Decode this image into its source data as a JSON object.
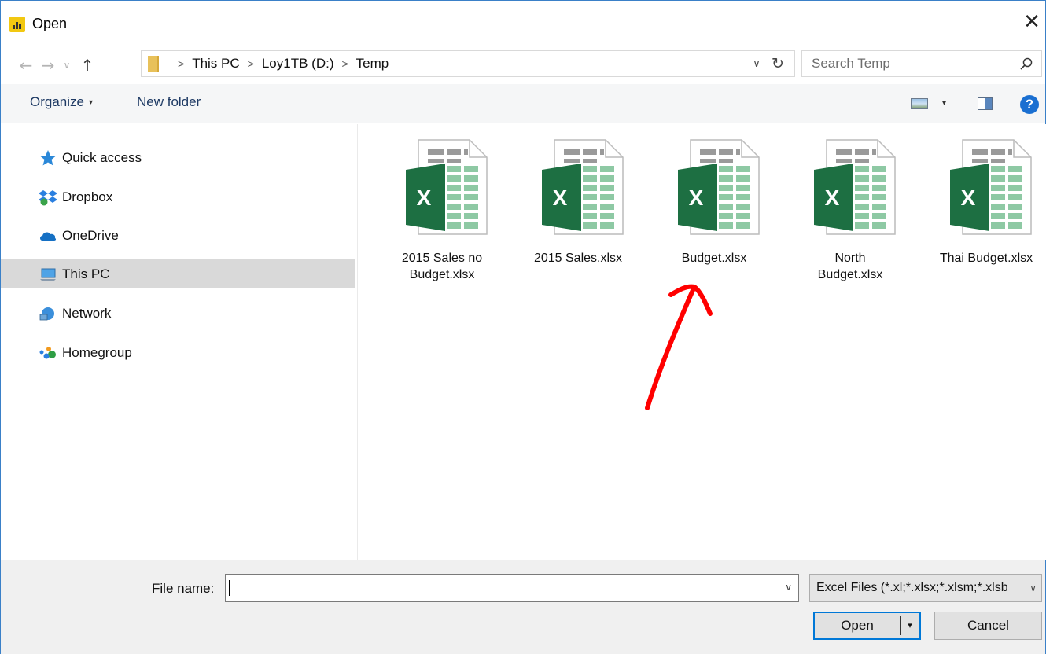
{
  "window": {
    "title": "Open",
    "close_glyph": "✕"
  },
  "nav_buttons": {
    "back_glyph": "←",
    "forward_glyph": "→",
    "recent_glyph": "∨",
    "up_glyph": "↑"
  },
  "address": {
    "breadcrumbs": [
      "This PC",
      "Loy1TB (D:)",
      "Temp"
    ],
    "separator": ">",
    "dropdown_glyph": "∨",
    "refresh_glyph": "↻"
  },
  "search": {
    "placeholder": "Search Temp"
  },
  "toolbar": {
    "organize_label": "Organize",
    "organize_caret": "▾",
    "new_folder_label": "New folder",
    "view_caret": "▾",
    "help_glyph": "?"
  },
  "sidebar": {
    "items": [
      {
        "label": "Quick access",
        "icon": "star-icon"
      },
      {
        "label": "Dropbox",
        "icon": "dropbox-icon"
      },
      {
        "label": "OneDrive",
        "icon": "cloud-icon"
      },
      {
        "label": "This PC",
        "icon": "computer-icon",
        "selected": true
      },
      {
        "label": "Network",
        "icon": "network-icon"
      },
      {
        "label": "Homegroup",
        "icon": "homegroup-icon"
      }
    ]
  },
  "files": [
    {
      "name_line1": "2015 Sales no",
      "name_line2": "Budget.xlsx",
      "icon": "excel-file-icon"
    },
    {
      "name_line1": "2015 Sales.xlsx",
      "name_line2": "",
      "icon": "excel-file-icon"
    },
    {
      "name_line1": "Budget.xlsx",
      "name_line2": "",
      "icon": "excel-file-icon"
    },
    {
      "name_line1": "North",
      "name_line2": "Budget.xlsx",
      "icon": "excel-file-icon"
    },
    {
      "name_line1": "Thai Budget.xlsx",
      "name_line2": "",
      "icon": "excel-file-icon"
    }
  ],
  "bottom": {
    "file_name_label": "File name:",
    "file_name_value": "",
    "file_type_filter": "Excel Files (*.xl;*.xlsx;*.xlsm;*.xlsb",
    "dropdown_glyph": "∨",
    "open_label": "Open",
    "open_split_glyph": "▾",
    "cancel_label": "Cancel"
  },
  "colors": {
    "accent": "#0078d7",
    "excel_green": "#1d6f42",
    "annotation_red": "#ff0000",
    "selected_row": "#d9d9d9"
  }
}
